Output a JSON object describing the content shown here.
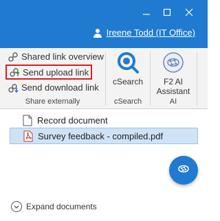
{
  "titlebar": {
    "user_name": "Ireene Todd (IT Office)",
    "color": "#1f7ad0"
  },
  "ribbon": {
    "share_externally": {
      "items": [
        {
          "label": "Shared link overview",
          "icon": "shared-link-icon"
        },
        {
          "label": "Send upload link",
          "icon": "upload-link-icon",
          "highlighted": true
        },
        {
          "label": "Send download link",
          "icon": "download-link-icon"
        }
      ],
      "group_label": "Share externally"
    },
    "csearch": {
      "button_label": "cSearch",
      "group_label": "cSearch",
      "icon": "csearch-icon"
    },
    "ai": {
      "button_label": "F2 AI Assistant",
      "group_label": "AI",
      "icon": "ai-brain-icon"
    },
    "highlight_color": "#d81e1e"
  },
  "documents": [
    {
      "name": "Record document",
      "icon": "document-icon",
      "selected": false
    },
    {
      "name": "Survey feedback - compiled.pdf",
      "icon": "pdf-icon",
      "selected": true
    }
  ],
  "footer": {
    "expand_label": "Expand documents"
  },
  "fab": {
    "icon": "ai-brain-icon"
  }
}
